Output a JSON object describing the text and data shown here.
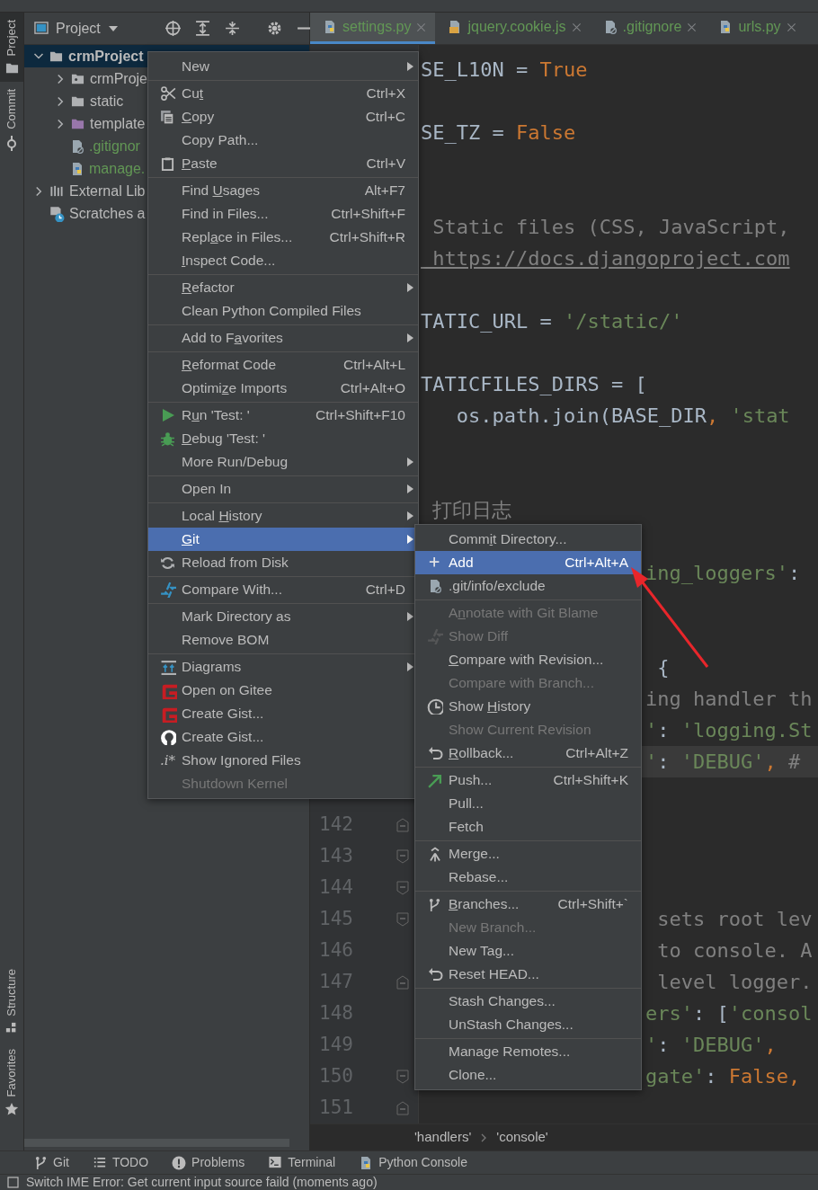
{
  "left_strip": {
    "top": [
      {
        "label": "Project",
        "selected": true
      },
      {
        "label": "Commit",
        "selected": false
      }
    ],
    "bottom": [
      {
        "label": "Structure",
        "selected": false
      },
      {
        "label": "Favorites",
        "selected": false
      }
    ]
  },
  "project_panel": {
    "title": "Project",
    "tree": [
      {
        "label": "crmProject",
        "selected": true,
        "expanded": true,
        "added": false,
        "children": [
          {
            "label": "crmProje",
            "selected": false,
            "expanded": false,
            "added": false
          },
          {
            "label": "static",
            "selected": false,
            "expanded": false,
            "added": false
          },
          {
            "label": "template",
            "selected": false,
            "expanded": false,
            "added": false
          },
          {
            "label": ".gitignor",
            "selected": false,
            "added": true
          },
          {
            "label": "manage.",
            "selected": false,
            "added": true
          }
        ]
      },
      {
        "label": "External Lib",
        "selected": false,
        "expanded": false,
        "added": false
      },
      {
        "label": "Scratches a",
        "selected": false,
        "added": false
      }
    ]
  },
  "tabs": [
    {
      "label": "settings.py",
      "selected": true
    },
    {
      "label": "jquery.cookie.js",
      "selected": false
    },
    {
      "label": ".gitignore",
      "selected": false
    },
    {
      "label": "urls.py",
      "selected": false
    }
  ],
  "editor": {
    "lines": [
      {
        "current": false,
        "code": [
          {
            "text": "SE_L10N = ",
            "kind": "plain"
          },
          {
            "text": "True",
            "kind": "keyword"
          }
        ]
      },
      {
        "current": false
      },
      {
        "current": false,
        "code": [
          {
            "text": "SE_TZ = ",
            "kind": "plain"
          },
          {
            "text": "False",
            "kind": "keyword"
          }
        ]
      },
      {
        "current": false
      },
      {
        "current": false
      },
      {
        "current": false,
        "code": [
          {
            "text": " Static files (CSS, JavaScript,",
            "kind": "comment"
          }
        ]
      },
      {
        "current": false,
        "code": [
          {
            "text": " https://docs.djangoproject.com",
            "kind": "link"
          }
        ]
      },
      {
        "current": false
      },
      {
        "current": false,
        "code": [
          {
            "text": "TATIC_URL = ",
            "kind": "plain"
          },
          {
            "text": "'/static/'",
            "kind": "string"
          }
        ]
      },
      {
        "current": false
      },
      {
        "current": false,
        "code": [
          {
            "text": "TATICFILES_DIRS = [",
            "kind": "plain"
          }
        ]
      },
      {
        "current": false,
        "code": [
          {
            "text": "   os.path.join(BASE_DIR",
            "kind": "plain"
          },
          {
            "text": ", ",
            "kind": "keyword"
          },
          {
            "text": "'stat",
            "kind": "string"
          }
        ]
      },
      {
        "current": false
      },
      {
        "current": false
      },
      {
        "current": false,
        "code": [
          {
            "text": " 打印日志",
            "kind": "comment"
          }
        ]
      },
      {
        "current": false
      },
      {
        "current": false,
        "code": [
          {
            "text": "ing_loggers'",
            "kind": "string"
          },
          {
            "text": ":",
            "kind": "plain"
          }
        ]
      },
      {
        "current": false
      },
      {
        "current": false
      },
      {
        "current": false,
        "code": [
          {
            "text": " {",
            "kind": "plain"
          }
        ]
      },
      {
        "current": false,
        "code": [
          {
            "text": "ing handler th",
            "kind": "comment"
          }
        ]
      },
      {
        "current": false,
        "code": [
          {
            "text": "'",
            "kind": "string"
          },
          {
            "text": ": ",
            "kind": "plain"
          },
          {
            "text": "'logging.St",
            "kind": "string"
          }
        ]
      },
      {
        "current": true,
        "code": [
          {
            "text": "'",
            "kind": "string"
          },
          {
            "text": ": ",
            "kind": "plain"
          },
          {
            "text": "'DEBUG'",
            "kind": "string"
          },
          {
            "text": ", ",
            "kind": "keyword"
          },
          {
            "text": "#",
            "kind": "comment"
          }
        ]
      },
      {
        "current": false
      },
      {
        "current": false,
        "number": "142"
      },
      {
        "current": false,
        "number": "143"
      },
      {
        "current": false,
        "number": "144"
      },
      {
        "current": false,
        "number": "145",
        "code": [
          {
            "text": " sets root lev",
            "kind": "comment"
          }
        ]
      },
      {
        "current": false,
        "number": "146",
        "code": [
          {
            "text": " to console. A",
            "kind": "comment"
          }
        ]
      },
      {
        "current": false,
        "number": "147",
        "code": [
          {
            "text": " level logger.",
            "kind": "comment"
          }
        ]
      },
      {
        "current": false,
        "number": "148",
        "code": [
          {
            "text": "ers'",
            "kind": "string"
          },
          {
            "text": ": [",
            "kind": "plain"
          },
          {
            "text": "'consol",
            "kind": "string"
          }
        ]
      },
      {
        "current": false,
        "number": "149",
        "code": [
          {
            "text": "'",
            "kind": "string"
          },
          {
            "text": ": ",
            "kind": "plain"
          },
          {
            "text": "'DEBUG'",
            "kind": "string"
          },
          {
            "text": ",",
            "kind": "keyword"
          }
        ]
      },
      {
        "current": false,
        "number": "150",
        "code": [
          {
            "text": "gate'",
            "kind": "string"
          },
          {
            "text": ": ",
            "kind": "plain"
          },
          {
            "text": "False,",
            "kind": "keyword"
          }
        ]
      },
      {
        "current": false,
        "number": "151"
      }
    ],
    "breadcrumb": [
      "'handlers'",
      "'console'"
    ]
  },
  "context_menu": {
    "items": [
      {
        "kind": "item",
        "label": "New",
        "submenu": true,
        "selected": false,
        "disabled": false
      },
      {
        "kind": "separator"
      },
      {
        "kind": "item",
        "label": "Cut",
        "shortcut": "Ctrl+X",
        "selected": false,
        "disabled": false
      },
      {
        "kind": "item",
        "label": "Copy",
        "shortcut": "Ctrl+C",
        "selected": false,
        "disabled": false
      },
      {
        "kind": "item",
        "label": "Copy Path...",
        "selected": false,
        "disabled": false
      },
      {
        "kind": "item",
        "label": "Paste",
        "shortcut": "Ctrl+V",
        "selected": false,
        "disabled": false
      },
      {
        "kind": "separator"
      },
      {
        "kind": "item",
        "label": "Find Usages",
        "shortcut": "Alt+F7",
        "selected": false,
        "disabled": false
      },
      {
        "kind": "item",
        "label": "Find in Files...",
        "shortcut": "Ctrl+Shift+F",
        "selected": false,
        "disabled": false
      },
      {
        "kind": "item",
        "label": "Replace in Files...",
        "shortcut": "Ctrl+Shift+R",
        "selected": false,
        "disabled": false
      },
      {
        "kind": "item",
        "label": "Inspect Code...",
        "selected": false,
        "disabled": false
      },
      {
        "kind": "separator"
      },
      {
        "kind": "item",
        "label": "Refactor",
        "submenu": true,
        "selected": false,
        "disabled": false
      },
      {
        "kind": "item",
        "label": "Clean Python Compiled Files",
        "selected": false,
        "disabled": false
      },
      {
        "kind": "separator"
      },
      {
        "kind": "item",
        "label": "Add to Favorites",
        "submenu": true,
        "selected": false,
        "disabled": false
      },
      {
        "kind": "separator"
      },
      {
        "kind": "item",
        "label": "Reformat Code",
        "shortcut": "Ctrl+Alt+L",
        "selected": false,
        "disabled": false
      },
      {
        "kind": "item",
        "label": "Optimize Imports",
        "shortcut": "Ctrl+Alt+O",
        "selected": false,
        "disabled": false
      },
      {
        "kind": "separator"
      },
      {
        "kind": "item",
        "label": "Run 'Test: '",
        "shortcut": "Ctrl+Shift+F10",
        "selected": false,
        "disabled": false
      },
      {
        "kind": "item",
        "label": "Debug 'Test: '",
        "selected": false,
        "disabled": false
      },
      {
        "kind": "item",
        "label": "More Run/Debug",
        "submenu": true,
        "selected": false,
        "disabled": false
      },
      {
        "kind": "separator"
      },
      {
        "kind": "item",
        "label": "Open In",
        "submenu": true,
        "selected": false,
        "disabled": false
      },
      {
        "kind": "separator"
      },
      {
        "kind": "item",
        "label": "Local History",
        "submenu": true,
        "selected": false,
        "disabled": false
      },
      {
        "kind": "item",
        "label": "Git",
        "submenu": true,
        "selected": true,
        "disabled": false
      },
      {
        "kind": "item",
        "label": "Reload from Disk",
        "selected": false,
        "disabled": false
      },
      {
        "kind": "separator"
      },
      {
        "kind": "item",
        "label": "Compare With...",
        "shortcut": "Ctrl+D",
        "selected": false,
        "disabled": false
      },
      {
        "kind": "separator"
      },
      {
        "kind": "item",
        "label": "Mark Directory as",
        "submenu": true,
        "selected": false,
        "disabled": false
      },
      {
        "kind": "item",
        "label": "Remove BOM",
        "selected": false,
        "disabled": false
      },
      {
        "kind": "separator"
      },
      {
        "kind": "item",
        "label": "Diagrams",
        "submenu": true,
        "selected": false,
        "disabled": false
      },
      {
        "kind": "item",
        "label": "Open on Gitee",
        "selected": false,
        "disabled": false
      },
      {
        "kind": "item",
        "label": "Create Gist...",
        "selected": false,
        "disabled": false
      },
      {
        "kind": "item",
        "label": "Create Gist...",
        "selected": false,
        "disabled": false
      },
      {
        "kind": "item",
        "label": "Show Ignored Files",
        "icon_text": ".i*",
        "selected": false,
        "disabled": false
      },
      {
        "kind": "item",
        "label": "Shutdown Kernel",
        "selected": false,
        "disabled": true
      }
    ]
  },
  "git_submenu": {
    "items": [
      {
        "kind": "item",
        "label": "Commit Directory...",
        "selected": false,
        "disabled": false
      },
      {
        "kind": "item",
        "label": "Add",
        "shortcut": "Ctrl+Alt+A",
        "selected": true,
        "disabled": false
      },
      {
        "kind": "item",
        "label": ".git/info/exclude",
        "selected": false,
        "disabled": false
      },
      {
        "kind": "separator"
      },
      {
        "kind": "item",
        "label": "Annotate with Git Blame",
        "selected": false,
        "disabled": true
      },
      {
        "kind": "item",
        "label": "Show Diff",
        "selected": false,
        "disabled": true
      },
      {
        "kind": "item",
        "label": "Compare with Revision...",
        "selected": false,
        "disabled": false
      },
      {
        "kind": "item",
        "label": "Compare with Branch...",
        "selected": false,
        "disabled": true
      },
      {
        "kind": "item",
        "label": "Show History",
        "selected": false,
        "disabled": false
      },
      {
        "kind": "item",
        "label": "Show Current Revision",
        "selected": false,
        "disabled": true
      },
      {
        "kind": "item",
        "label": "Rollback...",
        "shortcut": "Ctrl+Alt+Z",
        "selected": false,
        "disabled": false
      },
      {
        "kind": "separator"
      },
      {
        "kind": "item",
        "label": "Push...",
        "shortcut": "Ctrl+Shift+K",
        "selected": false,
        "disabled": false
      },
      {
        "kind": "item",
        "label": "Pull...",
        "selected": false,
        "disabled": false
      },
      {
        "kind": "item",
        "label": "Fetch",
        "selected": false,
        "disabled": false
      },
      {
        "kind": "separator"
      },
      {
        "kind": "item",
        "label": "Merge...",
        "selected": false,
        "disabled": false
      },
      {
        "kind": "item",
        "label": "Rebase...",
        "selected": false,
        "disabled": false
      },
      {
        "kind": "separator"
      },
      {
        "kind": "item",
        "label": "Branches...",
        "shortcut": "Ctrl+Shift+`",
        "selected": false,
        "disabled": false
      },
      {
        "kind": "item",
        "label": "New Branch...",
        "selected": false,
        "disabled": true
      },
      {
        "kind": "item",
        "label": "New Tag...",
        "selected": false,
        "disabled": false
      },
      {
        "kind": "item",
        "label": "Reset HEAD...",
        "selected": false,
        "disabled": false
      },
      {
        "kind": "separator"
      },
      {
        "kind": "item",
        "label": "Stash Changes...",
        "selected": false,
        "disabled": false
      },
      {
        "kind": "item",
        "label": "UnStash Changes...",
        "selected": false,
        "disabled": false
      },
      {
        "kind": "separator"
      },
      {
        "kind": "item",
        "label": "Manage Remotes...",
        "selected": false,
        "disabled": false
      },
      {
        "kind": "item",
        "label": "Clone...",
        "selected": false,
        "disabled": false
      }
    ]
  },
  "tool_windows": [
    {
      "label": "Git"
    },
    {
      "label": "TODO"
    },
    {
      "label": "Problems"
    },
    {
      "label": "Terminal"
    },
    {
      "label": "Python Console"
    }
  ],
  "status_bar": {
    "message": "Switch IME Error: Get current input source faild (moments ago)"
  }
}
